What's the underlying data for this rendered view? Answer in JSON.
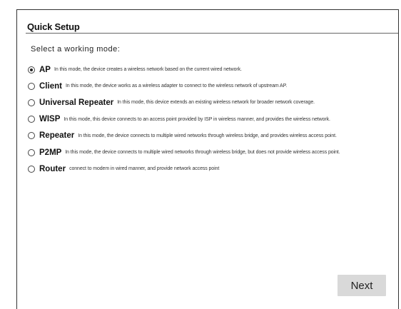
{
  "header": {
    "title": "Quick Setup"
  },
  "main": {
    "subtitle": "Select a working mode:",
    "options": [
      {
        "name": "AP",
        "description": "In this mode, the device creates a wireless network based on the current wired network.",
        "selected": true
      },
      {
        "name": "Client",
        "description": "In this mode, the device works as a wireless adapter to connect to the wireless network of upstream AP.",
        "selected": false
      },
      {
        "name": "Universal Repeater",
        "description": "In this mode, this device extends an existing wireless network for broader network coverage.",
        "selected": false
      },
      {
        "name": "WISP",
        "description": "In this mode, this device connects to an access point provided by ISP in wireless manner, and provides the wireless network.",
        "selected": false
      },
      {
        "name": "Repeater",
        "description": "In this mode, the device connects to multiple wired networks through wireless bridge, and provides wireless access point.",
        "selected": false
      },
      {
        "name": "P2MP",
        "description": "In this mode, the device connects to multiple wired networks through wireless bridge, but does not provide wireless access point.",
        "selected": false
      },
      {
        "name": "Router",
        "description": "connect to modem in wired manner, and provide network access point",
        "selected": false
      }
    ]
  },
  "footer": {
    "next_label": "Next"
  }
}
